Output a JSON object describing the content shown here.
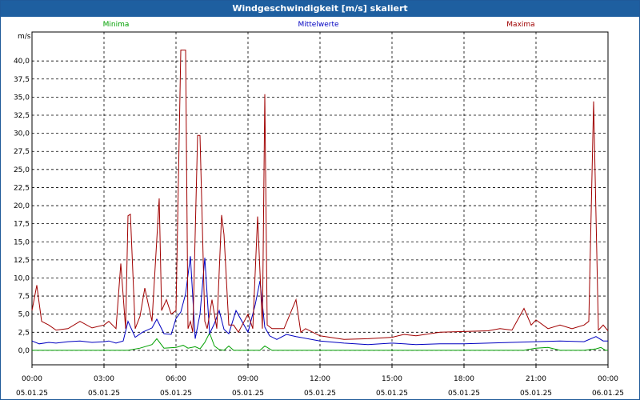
{
  "window": {
    "title": "Windgeschwindigkeit [m/s] skaliert"
  },
  "colors": {
    "title_bar": "#1e5fa0",
    "minima": "#00a000",
    "mittelwerte": "#0000c0",
    "maxima": "#a00000",
    "grid": "#000000"
  },
  "chart_data": {
    "type": "line",
    "title": "Windgeschwindigkeit [m/s] skaliert",
    "ylabel": "m/s",
    "ylim": [
      -2,
      44
    ],
    "xlim": [
      0,
      24
    ],
    "grid": true,
    "legend_placement": "top",
    "y_ticks": [
      "0,0",
      "2,5",
      "5,0",
      "7,5",
      "10,0",
      "12,5",
      "15,0",
      "17,5",
      "20,0",
      "22,5",
      "25,0",
      "27,5",
      "30,0",
      "32,5",
      "35,0",
      "37,5",
      "40,0"
    ],
    "x_ticks": [
      {
        "time": "00:00",
        "date": "05.01.25"
      },
      {
        "time": "03:00",
        "date": "05.01.25"
      },
      {
        "time": "06:00",
        "date": "05.01.25"
      },
      {
        "time": "09:00",
        "date": "05.01.25"
      },
      {
        "time": "12:00",
        "date": "05.01.25"
      },
      {
        "time": "15:00",
        "date": "05.01.25"
      },
      {
        "time": "18:00",
        "date": "05.01.25"
      },
      {
        "time": "21:00",
        "date": "05.01.25"
      },
      {
        "time": "00:00",
        "date": "06.01.25"
      }
    ],
    "series": [
      {
        "name": "Minima",
        "x": [
          0,
          1,
          2,
          3,
          3.5,
          4,
          4.5,
          5,
          5.2,
          5.5,
          6,
          6.3,
          6.5,
          6.8,
          7,
          7.2,
          7.4,
          7.6,
          7.8,
          8,
          8.2,
          8.4,
          9,
          9.5,
          9.7,
          10,
          12,
          15,
          18,
          20.5,
          21,
          21.5,
          22,
          23,
          23.5,
          23.7,
          23.9,
          24
        ],
        "y": [
          0,
          0,
          0,
          0,
          0,
          0,
          0.3,
          0.8,
          1.6,
          0.3,
          0.4,
          0.7,
          0.3,
          0.5,
          0.2,
          1.1,
          2.4,
          0.6,
          0.1,
          0,
          0.6,
          0,
          0,
          0,
          0.6,
          0,
          0,
          0,
          0,
          0,
          0.3,
          0.4,
          0,
          0,
          0.2,
          0.4,
          0,
          0
        ]
      },
      {
        "name": "Mittelwerte",
        "x": [
          0,
          0.3,
          0.7,
          1,
          1.5,
          2,
          2.5,
          3,
          3.2,
          3.5,
          3.8,
          4,
          4.3,
          4.6,
          5,
          5.2,
          5.5,
          5.8,
          6,
          6.2,
          6.4,
          6.6,
          6.8,
          7,
          7.2,
          7.4,
          7.6,
          7.8,
          8,
          8.2,
          8.5,
          9,
          9.3,
          9.5,
          9.7,
          9.9,
          10.2,
          10.6,
          11,
          12,
          13,
          14,
          15,
          16,
          17,
          18,
          19,
          20,
          21,
          22,
          23,
          23.5,
          23.8,
          24
        ],
        "y": [
          1.3,
          0.9,
          1.1,
          1.0,
          1.2,
          1.3,
          1.1,
          1.2,
          1.3,
          1.0,
          1.3,
          4.0,
          1.8,
          2.5,
          3.1,
          4.3,
          2.3,
          2.2,
          4.4,
          5.3,
          7.8,
          13.0,
          1.6,
          5.0,
          12.8,
          2.3,
          3.7,
          5.5,
          2.9,
          2.3,
          5.5,
          2.5,
          6.3,
          9.6,
          3.2,
          2.0,
          1.5,
          2.2,
          1.9,
          1.3,
          1.0,
          0.8,
          1.0,
          0.8,
          0.9,
          0.9,
          1.0,
          1.1,
          1.2,
          1.3,
          1.2,
          1.9,
          1.3,
          1.3
        ]
      },
      {
        "name": "Maxima",
        "x": [
          0,
          0.2,
          0.4,
          0.7,
          1,
          1.5,
          2,
          2.5,
          3,
          3.2,
          3.5,
          3.7,
          3.9,
          4,
          4.1,
          4.3,
          4.5,
          4.7,
          5,
          5.3,
          5.4,
          5.6,
          5.8,
          6,
          6.2,
          6.4,
          6.5,
          6.6,
          6.7,
          6.9,
          7,
          7.2,
          7.3,
          7.5,
          7.7,
          7.9,
          8,
          8.2,
          8.4,
          8.6,
          9,
          9.2,
          9.4,
          9.6,
          9.7,
          9.8,
          10,
          10.5,
          11,
          11.2,
          11.4,
          12,
          13,
          14,
          15,
          15.5,
          16,
          17,
          18,
          19,
          19.5,
          20,
          20.5,
          20.8,
          21,
          21.5,
          22,
          22.5,
          23,
          23.2,
          23.4,
          23.6,
          23.8,
          24
        ],
        "y": [
          5.5,
          9.0,
          4.0,
          3.5,
          2.8,
          3.0,
          4.0,
          3.1,
          3.5,
          4.0,
          3.0,
          12.0,
          3.0,
          18.6,
          18.8,
          3.0,
          4.7,
          8.6,
          4.0,
          21.0,
          5.5,
          7.0,
          5.0,
          5.5,
          41.5,
          41.5,
          3.0,
          4.0,
          2.5,
          29.7,
          29.7,
          4.0,
          3.0,
          7.0,
          3.0,
          18.7,
          16.0,
          3.5,
          3.5,
          2.5,
          5.0,
          3.0,
          18.5,
          3.0,
          35.4,
          3.5,
          3.0,
          3.0,
          7.0,
          2.5,
          3.0,
          2.0,
          1.5,
          1.6,
          1.8,
          2.2,
          2.0,
          2.5,
          2.6,
          2.7,
          3.0,
          2.8,
          5.8,
          3.5,
          4.2,
          3.0,
          3.5,
          3.0,
          3.5,
          4.0,
          34.4,
          2.8,
          3.5,
          2.7
        ]
      }
    ]
  }
}
